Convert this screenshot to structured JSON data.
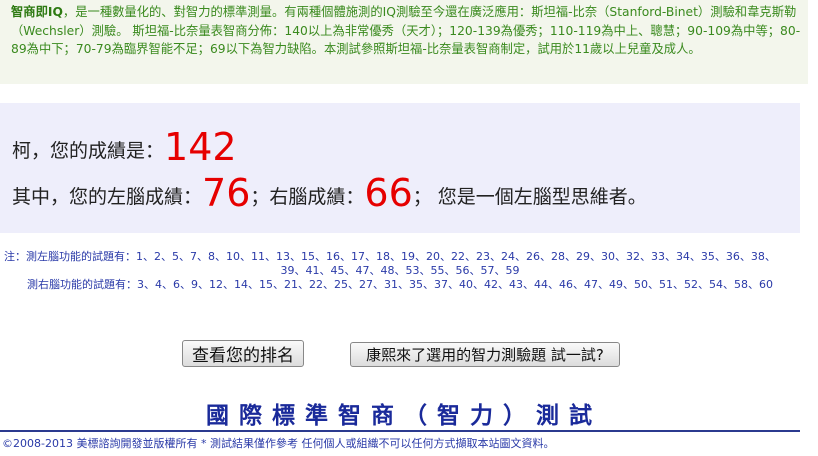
{
  "intro": {
    "term": "智商即IQ",
    "text": "，是一種數量化的、對智力的標準測量。有兩種個體施測的IQ測驗至今還在廣泛應用：斯坦福-比奈（Stanford-Binet）測驗和韋克斯勒（Wechsler）測驗。 斯坦福-比奈量表智商分佈：140以上為非常優秀（天才）；120-139為優秀；110-119為中上、聰慧；90-109為中等；80-89為中下；70-79為臨界智能不足；69以下為智力缺陷。本測試參照斯坦福-比奈量表智商制定，試用於11歲以上兒童及成人。"
  },
  "result": {
    "prefix": "柯，您的成績是：",
    "score": "142",
    "left_label": "其中，您的左腦成績：",
    "left_score": "76",
    "right_label": "；右腦成績：",
    "right_score": "66",
    "conclusion": "； 您是一個左腦型思維者。"
  },
  "notes": {
    "left_prefix": "注：測左腦功能的試題有：",
    "left_items": "1、2、5、7、8、10、11、13、15、16、17、18、19、20、22、23、24、26、28、29、30、32、33、34、35、36、38、",
    "left_items_cont": "39、41、45、47、48、53、55、56、57、59",
    "right_prefix": "測右腦功能的試題有：",
    "right_items": "3、4、6、9、12、14、15、21、22、25、27、31、35、37、40、42、43、44、46、47、49、50、51、52、54、58、60"
  },
  "buttons": {
    "rank": "查看您的排名",
    "try": "康熙來了選用的智力測驗題 試一試?"
  },
  "title": "國際標準智商（智力）測試",
  "footer": "©2008-2013 美標諮詢開發並版權所有 * 測試結果僅作參考  任何個人或組織不可以任何方式擷取本站圖文資料。"
}
